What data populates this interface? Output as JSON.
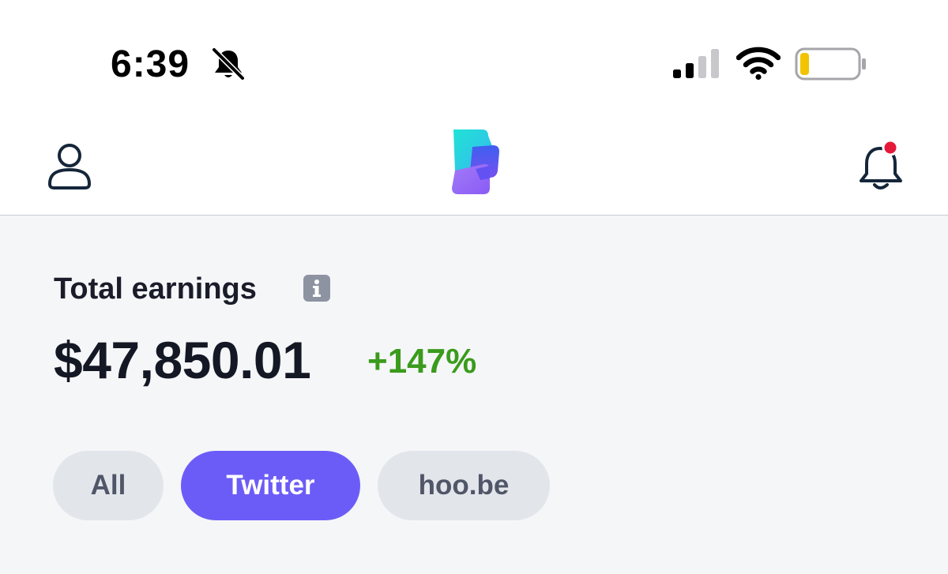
{
  "status_bar": {
    "time": "6:39"
  },
  "earnings": {
    "title": "Total earnings",
    "amount": "$47,850.01",
    "change": "+147%"
  },
  "filters": {
    "items": [
      {
        "label": "All",
        "active": false
      },
      {
        "label": "Twitter",
        "active": true
      },
      {
        "label": "hoo.be",
        "active": false
      }
    ]
  },
  "icons": {
    "mute": "bell-slash-icon",
    "signal": "cellular-signal-icon",
    "wifi": "wifi-icon",
    "battery": "battery-low-icon",
    "profile": "person-icon",
    "notifications": "bell-icon",
    "info": "info-icon"
  },
  "colors": {
    "accent": "#6c5cf7",
    "positive": "#3a9b1c",
    "notification_dot": "#e5193a",
    "battery_low": "#f2c300",
    "background": "#f5f6f8"
  }
}
